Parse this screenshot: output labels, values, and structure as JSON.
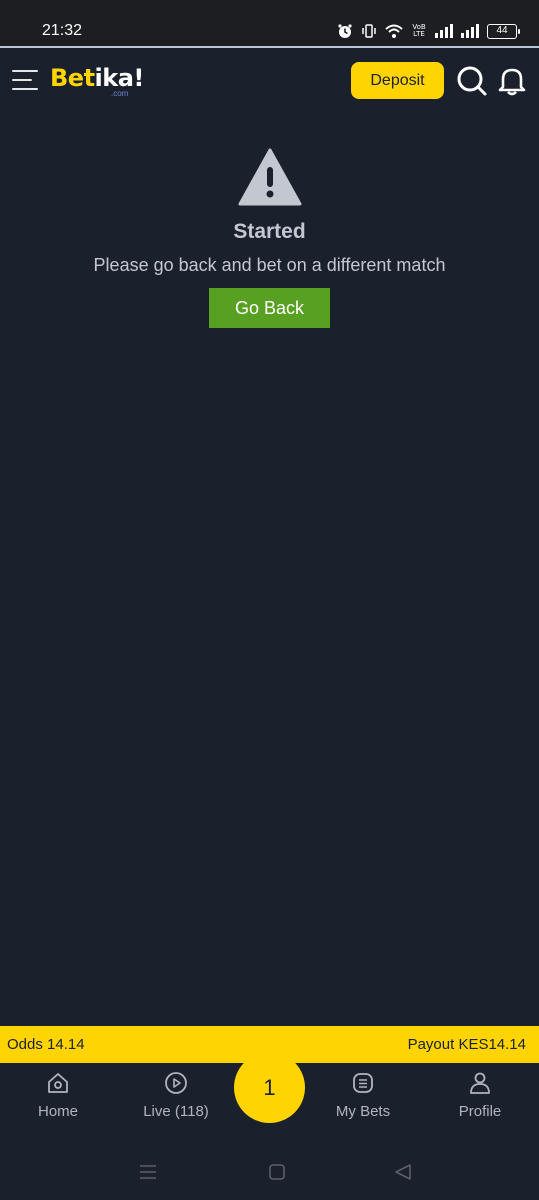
{
  "status_bar": {
    "time": "21:32",
    "volte_top": "VoB",
    "volte_bottom": "LTE",
    "battery": "44"
  },
  "header": {
    "logo_main": "Bet",
    "logo_accent": "ika!",
    "logo_domain": ".com",
    "deposit_label": "Deposit",
    "icons": [
      "menu-icon",
      "search-icon",
      "bell-icon"
    ]
  },
  "message": {
    "icon": "warning-icon",
    "title": "Started",
    "text": "Please go back and bet on a different match",
    "button_label": "Go Back"
  },
  "betslip": {
    "odds": "Odds 14.14",
    "payout": "Payout KES14.14",
    "count": "1"
  },
  "bottom_nav": {
    "home": "Home",
    "live": "Live (118)",
    "my_bets": "My Bets",
    "profile": "Profile"
  },
  "colors": {
    "background": "#1a212c",
    "accent": "#ffd400",
    "go_back": "#58a021",
    "muted_text": "#c3c8d0"
  }
}
